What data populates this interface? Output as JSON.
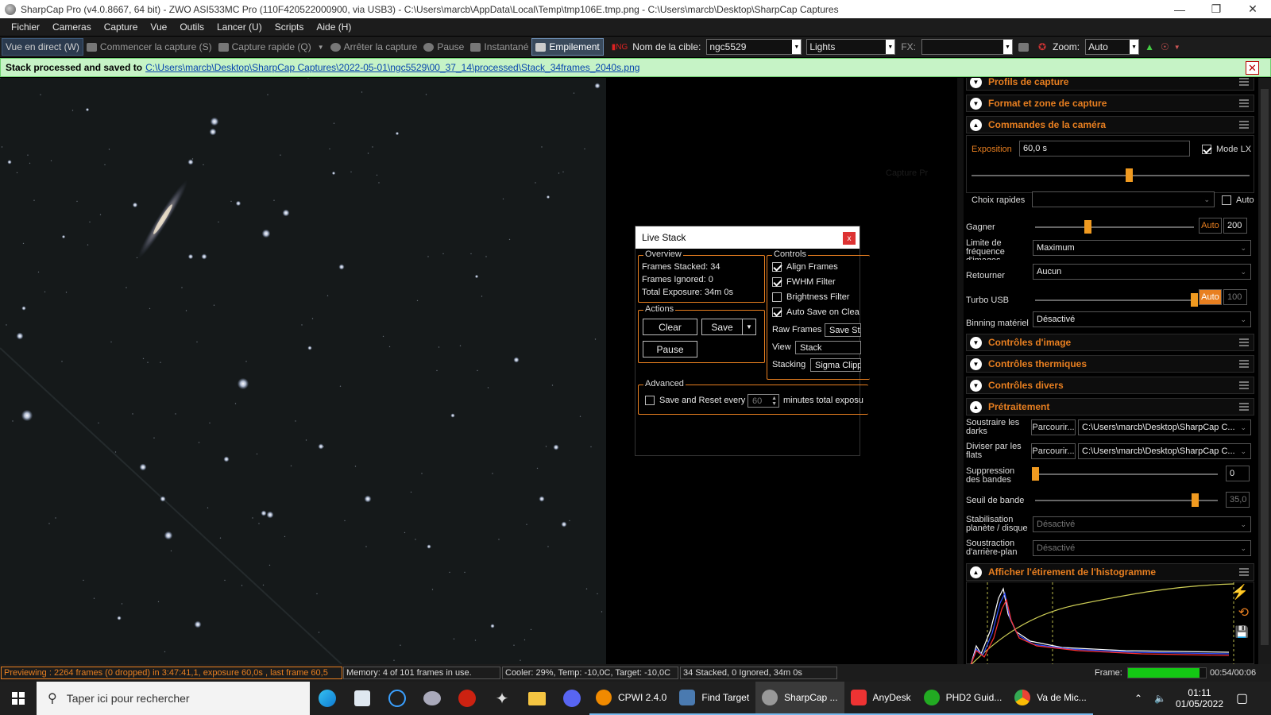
{
  "window": {
    "title": "SharpCap Pro (v4.0.8667, 64 bit) - ZWO ASI533MC Pro (110F420522000900, via USB3) - C:\\Users\\marcb\\AppData\\Local\\Temp\\tmp106E.tmp.png - C:\\Users\\marcb\\Desktop\\SharpCap Captures"
  },
  "menu": [
    "Fichier",
    "Cameras",
    "Capture",
    "Vue",
    "Outils",
    "Lancer (U)",
    "Scripts",
    "Aide (H)"
  ],
  "toolbar": {
    "live": "Vue en direct (W)",
    "start_capture": "Commencer la capture (S)",
    "quick_capture": "Capture rapide (Q)",
    "stop_capture": "Arrêter la capture",
    "pause": "Pause",
    "snapshot": "Instantané",
    "stacking": "Empilement",
    "target_label": "Nom de la cible:",
    "target_value": "ngc5529",
    "frame_type": "Lights",
    "fx_label": "FX:",
    "fx_value": "",
    "zoom_label": "Zoom:",
    "zoom_value": "Auto"
  },
  "notification": {
    "text": "Stack processed and saved to",
    "link": "C:\\Users\\marcb\\Desktop\\SharpCap Captures\\2022-05-01\\ngc5529\\00_37_14\\processed\\Stack_34frames_2040s.png"
  },
  "ghost_text": "Capture Pr",
  "live_stack": {
    "title": "Live Stack",
    "close": "x",
    "overview_title": "Overview",
    "frames_stacked": "Frames Stacked: 34",
    "frames_ignored": "Frames Ignored:  0",
    "total_exposure": "Total Exposure:  34m 0s",
    "actions_title": "Actions",
    "clear": "Clear",
    "save": "Save",
    "pause": "Pause",
    "controls_title": "Controls",
    "align": "Align Frames",
    "fwhm": "FWHM Filter",
    "brightness": "Brightness Filter",
    "autosave": "Auto Save on Clea",
    "raw_frames_label": "Raw Frames",
    "raw_frames_value": "Save St",
    "view_label": "View",
    "view_value": "Stack",
    "stacking_label": "Stacking",
    "stacking_value": "Sigma Clipp",
    "advanced_title": "Advanced",
    "save_reset": "Save and Reset every",
    "minutes_value": "60",
    "minutes_text": "minutes total exposu"
  },
  "panel": {
    "sections": {
      "profiles": "Profils de capture",
      "format": "Format et zone de capture",
      "camera": "Commandes de la caméra",
      "image": "Contrôles d'image",
      "thermal": "Contrôles thermiques",
      "misc": "Contrôles divers",
      "preprocessing": "Prétraitement",
      "histogram": "Afficher l'étirement de l'histogramme"
    },
    "exposure_label": "Exposition",
    "exposure_value": "60,0 s",
    "mode_lx": "Mode LX",
    "quick_choice_label": "Choix rapides",
    "quick_choice_auto": "Auto",
    "gain_label": "Gagner",
    "gain_auto": "Auto",
    "gain_value": "200",
    "gain_level": 0.33,
    "framerate_label": "Limite de fréquence d'images",
    "framerate_value": "Maximum",
    "flip_label": "Retourner",
    "flip_value": "Aucun",
    "turbo_label": "Turbo USB",
    "turbo_auto": "Auto",
    "turbo_value": "100",
    "turbo_level": 1.0,
    "binning_label": "Binning matériel",
    "binning_value": "Désactivé",
    "darks_label": "Soustraire les darks",
    "flats_label": "Diviser par les flats",
    "browse": "Parcourir...",
    "darks_path": "C:\\Users\\marcb\\Desktop\\SharpCap C...",
    "flats_path": "C:\\Users\\marcb\\Desktop\\SharpCap C...",
    "banding_label": "Suppression des bandes",
    "banding_value": "0",
    "banding_level": 0.0,
    "band_threshold_label": "Seuil de bande",
    "band_threshold_value": "35,0",
    "band_threshold_level": 0.875,
    "stabilisation_label": "Stabilisation planète / disque",
    "stabilisation_value": "Désactivé",
    "background_label": "Soustraction d'arrière-plan",
    "background_value": "Désactivé"
  },
  "status": {
    "preview": "Previewing : 2264 frames (0 dropped) in 3:47:41,1, exposure 60,0s , last frame 60,5",
    "memory": "Memory: 4 of 101 frames in use.",
    "cooler": "Cooler: 29%, Temp: -10,0C, Target: -10,0C",
    "stacked": "34 Stacked, 0 Ignored, 34m 0s",
    "frame_label": "Frame:",
    "frame_time": "00:54/00:06",
    "frame_progress": 0.92
  },
  "taskbar": {
    "search_placeholder": "Taper ici pour rechercher",
    "apps": [
      "CPWI 2.4.0",
      "Find Target",
      "SharpCap ...",
      "AnyDesk",
      "PHD2 Guid...",
      "Va de Mic..."
    ],
    "time": "01:11",
    "date": "01/05/2022"
  },
  "colors": {
    "accent": "#e87f20",
    "notification_bg": "#c6f3c6",
    "link": "#0645ad",
    "active_tab": "#3a4a5c"
  }
}
